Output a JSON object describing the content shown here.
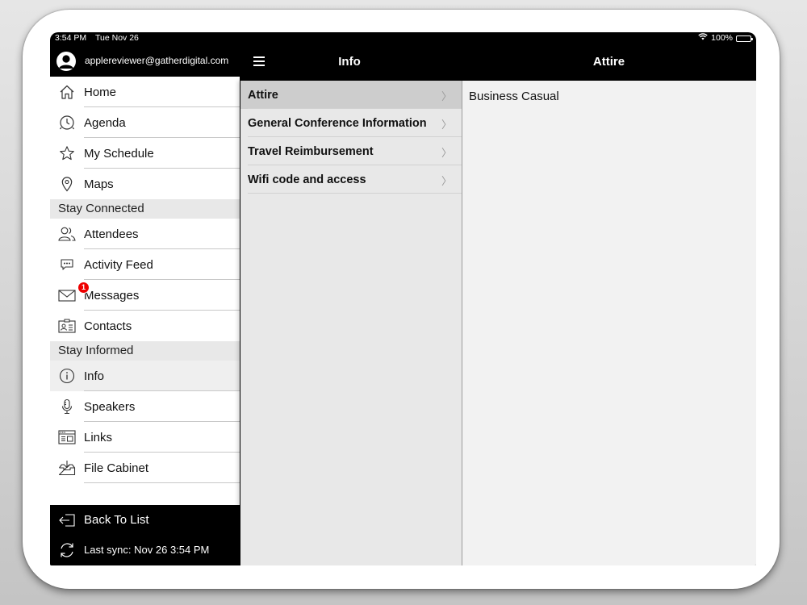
{
  "status": {
    "time": "3:54 PM",
    "date": "Tue Nov 26",
    "battery": "100%"
  },
  "account": {
    "email": "applereviewer@gatherdigital.com"
  },
  "nav": {
    "list_title": "Info",
    "detail_title": "Attire"
  },
  "sidebar": {
    "group1": [
      {
        "label": "Home",
        "icon": "home-icon"
      },
      {
        "label": "Agenda",
        "icon": "clock-icon"
      },
      {
        "label": "My Schedule",
        "icon": "star-icon"
      },
      {
        "label": "Maps",
        "icon": "map-pin-icon"
      }
    ],
    "section2_title": "Stay Connected",
    "group2": [
      {
        "label": "Attendees",
        "icon": "people-icon"
      },
      {
        "label": "Activity Feed",
        "icon": "chat-bubble-icon"
      },
      {
        "label": "Messages",
        "icon": "envelope-icon",
        "badge": "1"
      },
      {
        "label": "Contacts",
        "icon": "contact-card-icon"
      }
    ],
    "section3_title": "Stay Informed",
    "group3": [
      {
        "label": "Info",
        "icon": "info-icon",
        "selected": true
      },
      {
        "label": "Speakers",
        "icon": "microphone-icon"
      },
      {
        "label": "Links",
        "icon": "browser-window-icon"
      },
      {
        "label": "File Cabinet",
        "icon": "tray-download-icon"
      }
    ],
    "footer": {
      "back_label": "Back To List",
      "sync_label": "Last sync:  Nov 26 3:54 PM"
    }
  },
  "info_list": [
    {
      "label": "Attire",
      "selected": true
    },
    {
      "label": "General Conference Information"
    },
    {
      "label": "Travel Reimbursement"
    },
    {
      "label": "Wifi code and access"
    }
  ],
  "detail": {
    "content": "Business Casual"
  },
  "colors": {
    "header_bg": "#000000",
    "list_bg": "#e8e8e8",
    "selected_row": "#cdcdcd",
    "badge": "#e00000"
  }
}
